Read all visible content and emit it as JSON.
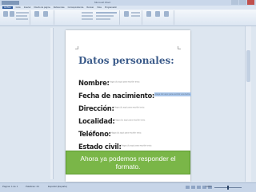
{
  "window": {
    "title": "Microsoft Word"
  },
  "ribbon": {
    "tabs": [
      "Archivo",
      "Inicio",
      "Insertar",
      "Diseño de página",
      "Referencias",
      "Correspondencia",
      "Revisar",
      "Vista",
      "Programador"
    ],
    "active_tab": "Programador"
  },
  "document": {
    "heading": "Datos personales:",
    "fields": [
      {
        "label": "Nombre:",
        "placeholder": "Haga clic aquí para escribir texto."
      },
      {
        "label": "Fecha de nacimiento:",
        "placeholder": "Haga clic aquí para escribir una fecha."
      },
      {
        "label": "Dirección:",
        "placeholder": "Haga clic aquí para escribir texto."
      },
      {
        "label": "Localidad:",
        "placeholder": "Haga clic aquí para escribir texto."
      },
      {
        "label": "Teléfono:",
        "placeholder": "Haga clic aquí para escribir texto."
      },
      {
        "label": "Estado civil:",
        "placeholder": "Haga clic aquí para escribir texto."
      }
    ]
  },
  "status_bar": {
    "page": "Página: 1 de 1",
    "words": "Palabras: 24",
    "language": "Español (España)",
    "zoom": "100%"
  },
  "caption": "Ahora ya podemos responder el formato."
}
